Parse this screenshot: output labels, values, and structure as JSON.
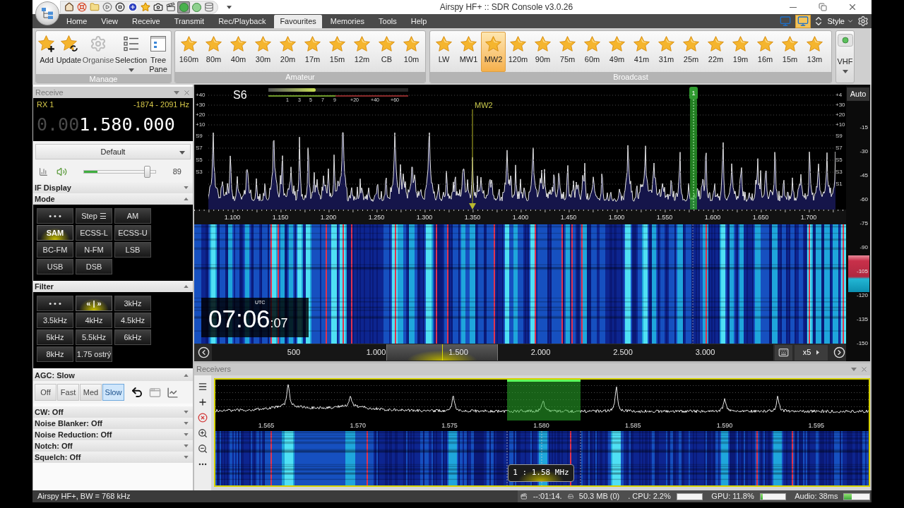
{
  "window": {
    "title": "Airspy HF+ :: SDR Console v3.0.26"
  },
  "quick_access": [
    {
      "selected": false
    },
    {
      "selected": false
    },
    {
      "selected": false
    },
    {
      "selected": false
    },
    {
      "selected": false
    },
    {
      "selected": false
    },
    {
      "selected": false
    },
    {
      "selected": false
    },
    {
      "selected": false
    },
    {
      "selected": true
    },
    {
      "selected": false
    },
    {
      "selected": false
    }
  ],
  "tabs": [
    {
      "label": "Home",
      "selected": false
    },
    {
      "label": "View",
      "selected": false
    },
    {
      "label": "Receive",
      "selected": false
    },
    {
      "label": "Transmit",
      "selected": false
    },
    {
      "label": "Rec/Playback",
      "selected": false
    },
    {
      "label": "Favourites",
      "selected": true
    },
    {
      "label": "Memories",
      "selected": false
    },
    {
      "label": "Tools",
      "selected": false
    },
    {
      "label": "Help",
      "selected": false
    }
  ],
  "view_buttons": [
    {
      "selected": false
    },
    {
      "selected": true
    }
  ],
  "style_menu": {
    "label": "Style"
  },
  "ribbon": {
    "manage": {
      "title": "Manage",
      "items": [
        {
          "kind": "add",
          "label": "Add",
          "disabled": false
        },
        {
          "kind": "update",
          "label": "Update",
          "disabled": false
        },
        {
          "kind": "organise",
          "label": "Organise",
          "disabled": true
        },
        {
          "kind": "selection",
          "label": "Selection",
          "disabled": false
        },
        {
          "kind": "tree",
          "label": "Tree Pane",
          "disabled": false
        }
      ]
    },
    "groups": [
      {
        "title": "Amateur",
        "items": [
          {
            "label": "160m",
            "selected": false
          },
          {
            "label": "80m",
            "selected": false
          },
          {
            "label": "40m",
            "selected": false
          },
          {
            "label": "30m",
            "selected": false
          },
          {
            "label": "20m",
            "selected": false
          },
          {
            "label": "17m",
            "selected": false
          },
          {
            "label": "15m",
            "selected": false
          },
          {
            "label": "12m",
            "selected": false
          },
          {
            "label": "CB",
            "selected": false
          },
          {
            "label": "10m",
            "selected": false
          }
        ]
      },
      {
        "title": "Broadcast",
        "items": [
          {
            "label": "LW",
            "selected": false
          },
          {
            "label": "MW1",
            "selected": false
          },
          {
            "label": "MW2",
            "selected": true
          },
          {
            "label": "120m",
            "selected": false
          },
          {
            "label": "90m",
            "selected": false
          },
          {
            "label": "75m",
            "selected": false
          },
          {
            "label": "60m",
            "selected": false
          },
          {
            "label": "49m",
            "selected": false
          },
          {
            "label": "41m",
            "selected": false
          },
          {
            "label": "31m",
            "selected": false
          },
          {
            "label": "25m",
            "selected": false
          },
          {
            "label": "22m",
            "selected": false
          },
          {
            "label": "19m",
            "selected": false
          },
          {
            "label": "16m",
            "selected": false
          },
          {
            "label": "15m",
            "selected": false
          },
          {
            "label": "13m",
            "selected": false
          }
        ]
      }
    ],
    "vhf": {
      "label": "VHF"
    }
  },
  "receive_panel": {
    "title": "Receive",
    "rx_label": "RX 1",
    "filter_range": "-1874 - 2091 Hz",
    "frequency_dim": "0.00",
    "frequency": "1.580.000",
    "preset": "Default",
    "volume": {
      "level": 0.89,
      "reading": "89"
    },
    "audio_meter": {
      "level": 0.19
    },
    "sections": [
      {
        "kind": "collapsed",
        "title": "IF Display",
        "expanded": false
      },
      {
        "kind": "modes",
        "title": "Mode",
        "expanded": true,
        "buttons": [
          {
            "label": "• • •",
            "selected": false
          },
          {
            "label": "Step ☰",
            "selected": false
          },
          {
            "label": "AM",
            "selected": false
          },
          {
            "label": "SAM",
            "selected": true
          },
          {
            "label": "ECSS-L",
            "selected": false
          },
          {
            "label": "ECSS-U",
            "selected": false
          },
          {
            "label": "BC-FM",
            "selected": false
          },
          {
            "label": "N-FM",
            "selected": false
          },
          {
            "label": "LSB",
            "selected": false
          },
          {
            "label": "USB",
            "selected": false
          },
          {
            "label": "DSB",
            "selected": false
          }
        ]
      },
      {
        "kind": "filters",
        "title": "Filter",
        "expanded": true,
        "buttons": [
          {
            "label": "• • •",
            "selected": false
          },
          {
            "label": "« | »",
            "selected": true
          },
          {
            "label": "3kHz",
            "selected": false
          },
          {
            "label": "3.5kHz",
            "selected": false
          },
          {
            "label": "4kHz",
            "selected": false
          },
          {
            "label": "4.5kHz",
            "selected": false
          },
          {
            "label": "5kHz",
            "selected": false
          },
          {
            "label": "5.5kHz",
            "selected": false
          },
          {
            "label": "6kHz",
            "selected": false
          },
          {
            "label": "8kHz",
            "selected": false
          },
          {
            "label": "1.75 ostrý",
            "selected": false
          }
        ]
      },
      {
        "kind": "agc",
        "title": "AGC: Slow",
        "expanded": true,
        "buttons": [
          {
            "label": "Off",
            "selected": false
          },
          {
            "label": "Fast",
            "selected": false
          },
          {
            "label": "Med",
            "selected": false
          },
          {
            "label": "Slow",
            "selected": true
          }
        ]
      },
      {
        "kind": "collapsed",
        "title": "CW: Off",
        "expanded": false
      },
      {
        "kind": "collapsed",
        "title": "Noise Blanker: Off",
        "expanded": false
      },
      {
        "kind": "collapsed",
        "title": "Noise Reduction: Off",
        "expanded": false
      },
      {
        "kind": "collapsed",
        "title": "Notch: Off",
        "expanded": false
      },
      {
        "kind": "collapsed",
        "title": "Squelch: Off",
        "expanded": false
      }
    ]
  },
  "spectrum": {
    "s_reading": "S6",
    "s_meter": {
      "level": 0.34,
      "scale": [
        "1",
        "3",
        "5",
        "7",
        "9",
        "+20",
        "+40",
        "+60"
      ]
    },
    "scale_left": [
      "+40",
      "+30",
      "+20",
      "+10",
      "S9",
      "S7",
      "S5",
      "S3"
    ],
    "scale_right": [
      "+4",
      "+30",
      "+20",
      "+10",
      "S9",
      "S7",
      "S5",
      "S3",
      "S1"
    ],
    "bookmark": {
      "label": "MW2"
    },
    "receiver_marker": {
      "label": "1"
    },
    "freq_ticks": [
      "1.100",
      "1.150",
      "1.200",
      "1.250",
      "1.300",
      "1.350",
      "1.400",
      "1.450",
      "1.500",
      "1.550",
      "1.600",
      "1.650",
      "1.700"
    ]
  },
  "db_scale": {
    "mode": "Auto",
    "ticks": [
      "-15",
      "-30",
      "-45",
      "-60",
      "-75",
      "-90",
      "-105",
      "-120",
      "-135",
      "-150"
    ]
  },
  "waterfall": {
    "clock": {
      "zone": "UTC",
      "time": "07:06",
      "seconds": ":07"
    }
  },
  "scroller": {
    "ticks": [
      "500",
      "1.000",
      "1.500",
      "2.000",
      "2.500",
      "3.000"
    ],
    "zoom": "x5"
  },
  "receivers_panel": {
    "title": "Receivers",
    "freq_ticks": [
      "1.565",
      "1.570",
      "1.575",
      "1.580",
      "1.585",
      "1.590",
      "1.595"
    ],
    "receiver_label": "1 : 1.58 MHz"
  },
  "status_bar": {
    "device": "Airspy HF+, BW = 768 kHz",
    "elapsed": "--:01:14.",
    "memory": "50.3 MB (0)",
    "meters": [
      {
        "label": ". CPU: 2.2%",
        "level": 0.02
      },
      {
        "label": "GPU: 11.8%",
        "level": 0.1
      },
      {
        "label": "Audio: 38ms",
        "level": 0.3
      }
    ]
  }
}
